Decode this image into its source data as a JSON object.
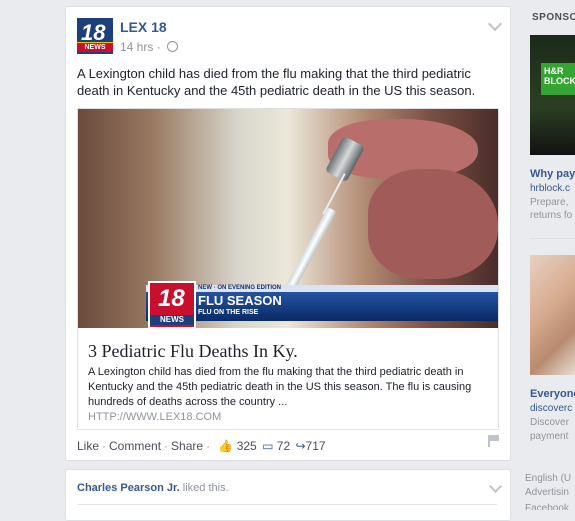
{
  "post": {
    "page_name": "LEX 18",
    "avatar_num": "18",
    "avatar_news": "NEWS",
    "time": "14 hrs",
    "text": "A Lexington child has died from the flu making that the third pediatric death in Kentucky and the 45th pediatric death in the US this season.",
    "image_overlay": {
      "kicker": "NEW · ON EVENING EDITION",
      "title": "FLU SEASON",
      "subtitle": "FLU ON THE RISE",
      "logo_num": "18",
      "logo_news": "NEWS"
    },
    "link": {
      "title": "3 Pediatric Flu Deaths In Ky.",
      "description": "A Lexington child has died from the flu making that the third pediatric death in Kentucky and the 45th pediatric death in the US this season. The flu is causing hundreds of deaths across the country ...",
      "domain": "HTTP://WWW.LEX18.COM"
    },
    "actions": {
      "like": "Like",
      "comment": "Comment",
      "share": "Share",
      "likes_count": "325",
      "comments_count": "72",
      "shares_count": "717"
    }
  },
  "activity": {
    "name": "Charles Pearson Jr.",
    "action": "liked this."
  },
  "sidebar": {
    "sponsored": "SPONSORED",
    "ad1": {
      "logo": "H&R BLOCK",
      "title": "Why pay",
      "domain": "hrblock.c",
      "text_1": "Prepare,",
      "text_2": "returns fo"
    },
    "ad2": {
      "title": "Everyone",
      "title_2": "discoverc",
      "text_1": "Discover",
      "text_2": "payment"
    },
    "footer_1": "English (U",
    "footer_2": "Advertisin",
    "footer_3": "Facebook"
  }
}
